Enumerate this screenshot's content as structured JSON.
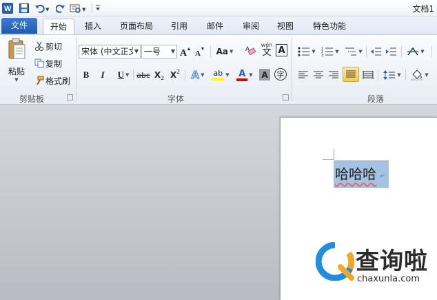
{
  "titlebar": {
    "doc_title": "文档1"
  },
  "tabs": {
    "file": "文件",
    "home": "开始",
    "insert": "插入",
    "layout": "页面布局",
    "references": "引用",
    "mailings": "邮件",
    "review": "审阅",
    "view": "视图",
    "special": "特色功能"
  },
  "clipboard": {
    "paste": "粘贴",
    "cut": "剪切",
    "copy": "复制",
    "format_painter": "格式刷",
    "label": "剪贴板"
  },
  "font": {
    "family_value": "宋体 (中文正文",
    "size_value": "一号",
    "change_case": "Aa",
    "pinyin_top": "wén",
    "pinyin_char": "文",
    "border_char": "A",
    "bold": "B",
    "italic": "I",
    "underline": "U",
    "strike": "abc",
    "subscript": "X",
    "subscript_mark": "2",
    "superscript": "X",
    "superscript_mark": "2",
    "effects": "A",
    "highlight": "ab",
    "color": "A",
    "shading": "A",
    "enclose": "字",
    "label": "字体"
  },
  "paragraph": {
    "label": "段落"
  },
  "document": {
    "text": "哈哈哈",
    "para_mark": "↵"
  },
  "watermark": {
    "text": "查询啦",
    "url": "chaxunla.com"
  },
  "colors": {
    "file_tab": "#2a67c4",
    "selection": "#a6c2e2",
    "highlight_yellow": "#ffff00",
    "font_red": "#e00000",
    "watermark_blue": "#1e8fe0",
    "watermark_orange": "#f5a623"
  }
}
